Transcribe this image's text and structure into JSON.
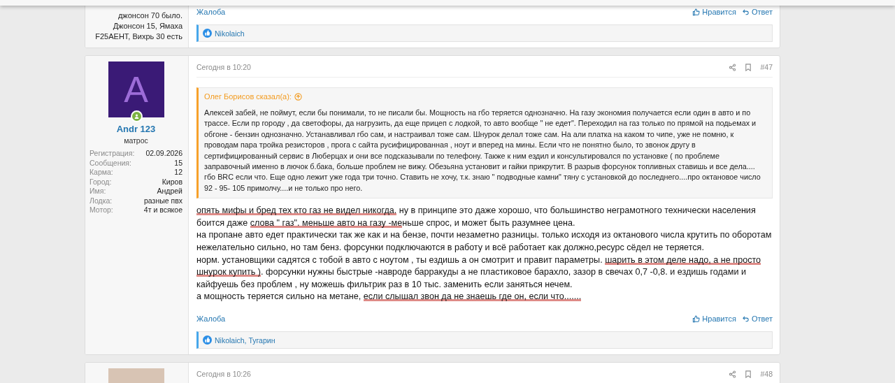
{
  "previous_post": {
    "author_details_tail": "джонсон 70 было. Джонсон 15, Ямаха F25AEHT, Вихрь 30 есть",
    "actions": {
      "report": "Жалоба",
      "like": "Нравится",
      "reply": "Ответ"
    },
    "likes": "Nikolaich"
  },
  "posts": [
    {
      "avatar": {
        "kind": "letter",
        "letter": "A"
      },
      "online": true,
      "username": "Andr 123",
      "user_title": "матрос",
      "details": [
        {
          "label": "Регистрация:",
          "value": "02.09.2026"
        },
        {
          "label": "Сообщения:",
          "value": "15"
        },
        {
          "label": "Карма:",
          "value": "12"
        },
        {
          "label": "Город:",
          "value": "Киров"
        },
        {
          "label": "Имя:",
          "value": "Андрей"
        },
        {
          "label": "Лодка:",
          "value": "разные пвх"
        },
        {
          "label": "Мотор:",
          "value": "4т и всякое"
        }
      ],
      "time": "Сегодня в 10:20",
      "number": "#47",
      "quote": {
        "author": "Олег Борисов сказал(а):",
        "text": "Алексей забей, не поймут, если бы понимали, то не писали бы. Мощность на гбо теряется однозначно. На газу экономия получается если один в авто и по трассе. Если пр городу , да светофоры, да нагрузить, да еще прицеп с лодкой, то авто вообще \" не едет\". Переходил на газ только по прямой на подьемах и обгоне - бензин однозначно. Устанавливал гбо сам, и настраивал тоже сам. Шнурок делал тоже сам. На али платка на каком то чипе, уже не помню, к проводам пара тройка резисторов , прога с сайта русифицированная , ноут и вперед на мины. Если что не понятно было, то звонок другу в сертифицированный сервис в Люберцах и они все подсказывали по телефону. Также к ним ездил и консультировался по установке ( по проблеме заправочный именно в лючок б.бака, больше проблем не вижу. Обезьяна установит и гайки прикрутит. В разрыв форсунок топливных ставишь и все дела.... гбо BRC если что. Еще одно лежит уже года три точно. Ставить не хочу, т.к. знаю \" подводные камни\" тяну с установкой до последнего....про октановое число 92 - 95- 105 примолчу....и не только про него."
      },
      "body": [
        [
          {
            "text": "опять мифы и бред тех кто газ не видел никогда.",
            "underlined": true
          },
          {
            "text": " ну в принципе это даже хорошо, что большинство неграмотного технически населения боится даже ",
            "underlined": false
          },
          {
            "text": "слова \" газ\". меньше авто на газу -ме",
            "underlined": true
          },
          {
            "text": "ньше спрос, и может быть разумнее цена.",
            "underlined": false
          }
        ],
        [
          {
            "text": "на пропане авто едет практически так же как и на бензе, почти незаметно разницы. только исходя из октанового числа крутить по оборотам нежелательно сильно, но там бенз. форсунки подключаются в работу и всё работает как должно,ресурс сёдел не теряется.",
            "underlined": false
          }
        ],
        [
          {
            "text": "норм. установщики садятся с тобой в авто с ноутом , ты ездишь а он смотрит и правит параметры. ",
            "underlined": false
          },
          {
            "text": "шарить в этом деле надо, а не просто шнурок купить )",
            "underlined": true
          },
          {
            "text": ". форсунки нужны быстрые -навроде барракуды а не пластиковое барахло, зазор в свечах 0,7 -0,8. и ездишь годами и кайфуешь без проблем , ну можешь фильтрик раз в 10 тыс. заменить если заняться нечем.",
            "underlined": false
          }
        ],
        [
          {
            "text": "а мощность теряется сильно на метане, ",
            "underlined": false
          },
          {
            "text": "если слышал звон да не знаешь где он, если что.......",
            "underlined": true
          }
        ]
      ],
      "actions": {
        "report": "Жалоба",
        "like": "Нравится",
        "reply": "Ответ"
      },
      "likes": "Nikolaich, Тугарин"
    },
    {
      "avatar": {
        "kind": "photo"
      },
      "time": "Сегодня в 10:26",
      "number": "#48"
    }
  ]
}
